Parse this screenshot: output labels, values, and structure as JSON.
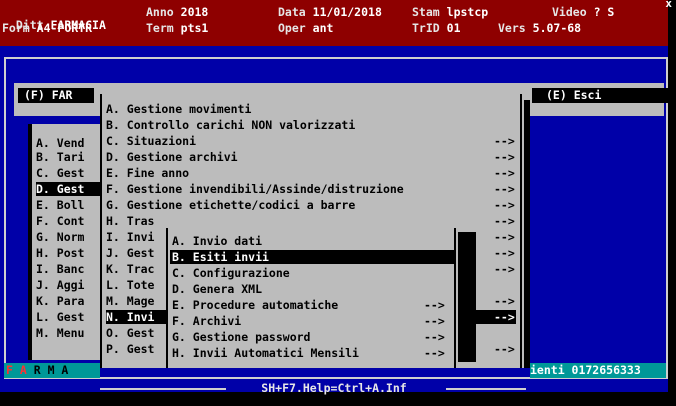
{
  "header": {
    "row1": [
      {
        "label": "Ditt",
        "value": "FARMACIA"
      },
      {
        "label": "Anno",
        "value": "2018"
      },
      {
        "label": "Data",
        "value": "11/01/2018"
      },
      {
        "label": "Stam",
        "value": "lpstcp"
      },
      {
        "label": "Video",
        "value": "? S"
      }
    ],
    "row2": [
      {
        "label": "Form",
        "value": "A4-PORTR"
      },
      {
        "label": "Term",
        "value": "pts1"
      },
      {
        "label": "Oper",
        "value": "ant"
      },
      {
        "label": "TrID",
        "value": "01"
      },
      {
        "label": "Vers",
        "value": "5.07-68"
      }
    ],
    "close": "x"
  },
  "top_buttons": {
    "left": "(F) FAR",
    "right": "(E) Esci"
  },
  "left_menu": [
    "A. Vend",
    "B. Tari",
    "C. Gest",
    "D. Gest",
    "E. Boll",
    "F. Cont",
    "G. Norm",
    "H. Post",
    "I. Banc",
    "J. Aggi",
    "K. Para",
    "L. Gest",
    "M. Menu"
  ],
  "main_menu": [
    {
      "label": "A. Gestione movimenti",
      "arrow": ""
    },
    {
      "label": "B. Controllo carichi NON valorizzati",
      "arrow": ""
    },
    {
      "label": "C. Situazioni",
      "arrow": "-->"
    },
    {
      "label": "D. Gestione archivi",
      "arrow": "-->"
    },
    {
      "label": "E. Fine anno",
      "arrow": "-->"
    },
    {
      "label": "F. Gestione invendibili/Assinde/distruzione",
      "arrow": "-->"
    },
    {
      "label": "G. Gestione etichette/codici a barre",
      "arrow": "-->"
    },
    {
      "label": "H. Tras",
      "arrow": "-->"
    },
    {
      "label": "I. Invi",
      "arrow": "-->"
    },
    {
      "label": "J. Gest",
      "arrow": "-->"
    },
    {
      "label": "K. Trac",
      "arrow": "-->"
    },
    {
      "label": "L. Tote",
      "arrow": ""
    },
    {
      "label": "M. Mage",
      "arrow": "-->"
    },
    {
      "label": "N. Invi",
      "arrow": "-->"
    },
    {
      "label": "O. Gest",
      "arrow": ""
    },
    {
      "label": "P. Gest",
      "arrow": "-->"
    }
  ],
  "sub_menu": [
    {
      "label": "A. Invio dati",
      "arrow": ""
    },
    {
      "label": "B. Esiti invii",
      "arrow": ""
    },
    {
      "label": "C. Configurazione",
      "arrow": ""
    },
    {
      "label": "D. Genera XML",
      "arrow": ""
    },
    {
      "label": "E. Procedure automatiche",
      "arrow": "-->"
    },
    {
      "label": "F. Archivi",
      "arrow": "-->"
    },
    {
      "label": "G. Gestione password",
      "arrow": "-->"
    },
    {
      "label": "H. Invii Automatici Mensili",
      "arrow": "-->"
    }
  ],
  "status": {
    "left_red": "F A",
    "left_rest": "R M A",
    "right": "ienti 0172656333"
  },
  "help": "SH+F7.Help=Ctrl+A.Inf"
}
